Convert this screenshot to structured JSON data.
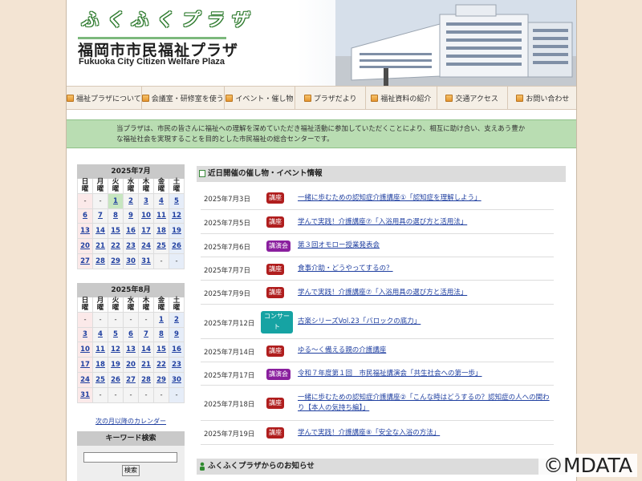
{
  "header": {
    "logo_chars": [
      "ふ",
      "く",
      "ふ",
      "く",
      "プ",
      "ラ",
      "ザ"
    ],
    "title": "福岡市市民福祉プラザ",
    "subtitle": "Fukuoka City Citizen Welfare Plaza"
  },
  "nav": {
    "items": [
      {
        "label": "福祉プラザについて"
      },
      {
        "label": "会議室・研修室を使う"
      },
      {
        "label": "イベント・催し物"
      },
      {
        "label": "プラザだより"
      },
      {
        "label": "福祉資料の紹介"
      },
      {
        "label": "交通アクセス"
      },
      {
        "label": "お問い合わせ"
      }
    ]
  },
  "intro": {
    "text": "当プラザは、市民の皆さんに福祉への理解を深めていただき福祉活動に参加していただくことにより、相互に助け合い、支えあう豊かな福祉社会を実現することを目的とした市民福祉の総合センターです。"
  },
  "calendar_july": {
    "title": "2025年7月",
    "weekdays": [
      [
        "日",
        "曜"
      ],
      [
        "月",
        "曜"
      ],
      [
        "火",
        "曜"
      ],
      [
        "水",
        "曜"
      ],
      [
        "木",
        "曜"
      ],
      [
        "金",
        "曜"
      ],
      [
        "土",
        "曜"
      ]
    ],
    "cells": [
      "-",
      "-",
      "1",
      "2",
      "3",
      "4",
      "5",
      "6",
      "7",
      "8",
      "9",
      "10",
      "11",
      "12",
      "13",
      "14",
      "15",
      "16",
      "17",
      "18",
      "19",
      "20",
      "21",
      "22",
      "23",
      "24",
      "25",
      "26",
      "27",
      "28",
      "29",
      "30",
      "31",
      "-",
      "-"
    ],
    "today": "1"
  },
  "calendar_august": {
    "title": "2025年8月",
    "weekdays": [
      [
        "日",
        "曜"
      ],
      [
        "月",
        "曜"
      ],
      [
        "火",
        "曜"
      ],
      [
        "水",
        "曜"
      ],
      [
        "木",
        "曜"
      ],
      [
        "金",
        "曜"
      ],
      [
        "土",
        "曜"
      ]
    ],
    "cells": [
      "-",
      "-",
      "-",
      "-",
      "-",
      "1",
      "2",
      "3",
      "4",
      "5",
      "6",
      "7",
      "8",
      "9",
      "10",
      "11",
      "12",
      "13",
      "14",
      "15",
      "16",
      "17",
      "18",
      "19",
      "20",
      "21",
      "22",
      "23",
      "24",
      "25",
      "26",
      "27",
      "28",
      "29",
      "30",
      "31",
      "-",
      "-",
      "-",
      "-",
      "-",
      "-"
    ]
  },
  "sidebar": {
    "next_calendar_link": "次の月以降のカレンダー",
    "keyword_title": "キーワード検索",
    "search_button": "検索"
  },
  "events": {
    "heading": "近日開催の催し物・イベント情報",
    "items": [
      {
        "date": "2025年7月3日",
        "badge": "講座",
        "badge_color": "red",
        "title": "一緒に歩むための認知症介護講座①「認知症を理解しよう」"
      },
      {
        "date": "2025年7月5日",
        "badge": "講座",
        "badge_color": "red",
        "title": "学んで実践！介護講座⑦「入浴用具の選び方と活用法」"
      },
      {
        "date": "2025年7月6日",
        "badge": "講演会",
        "badge_color": "purple",
        "title": "第３回オモロー授業発表会"
      },
      {
        "date": "2025年7月7日",
        "badge": "講座",
        "badge_color": "red",
        "title": "食事介助・どうやってするの？"
      },
      {
        "date": "2025年7月9日",
        "badge": "講座",
        "badge_color": "red",
        "title": "学んで実践！介護講座⑦「入浴用具の選び方と活用法」"
      },
      {
        "date": "2025年7月12日",
        "badge": "コンサート",
        "badge_color": "teal",
        "title": "古楽シリーズVol.23「バロックの底力」"
      },
      {
        "date": "2025年7月14日",
        "badge": "講座",
        "badge_color": "red",
        "title": "ゆる～く備える親の介護講座"
      },
      {
        "date": "2025年7月17日",
        "badge": "講演会",
        "badge_color": "purple",
        "title": "令和７年度第１回　市民福祉講演会「共生社会への第一歩」"
      },
      {
        "date": "2025年7月18日",
        "badge": "講座",
        "badge_color": "red",
        "title": "一緒に歩むための認知症介護講座②「こんな時はどうするの？認知症の人への関わり【本人の気持ち編】」"
      },
      {
        "date": "2025年7月19日",
        "badge": "講座",
        "badge_color": "red",
        "title": "学んで実践！介護講座⑧「安全な入浴の方法」"
      }
    ]
  },
  "notices": {
    "heading": "ふくふくプラザからのお知らせ"
  },
  "watermark": "©MDATA",
  "colors": {
    "intro_bg": "#b9ddb2",
    "badge_red": "#b01e1e",
    "badge_purple": "#8a1f9e",
    "badge_teal": "#16a3a3",
    "link": "#1f3fa0"
  }
}
